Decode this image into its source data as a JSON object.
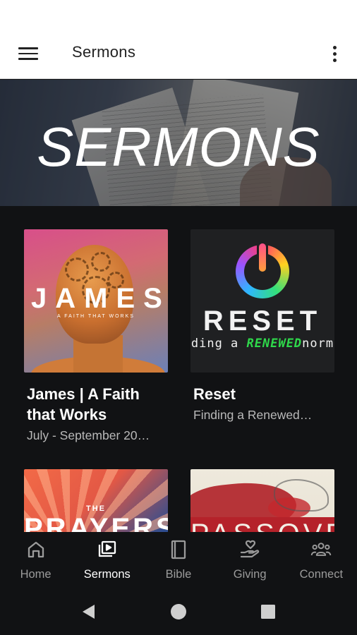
{
  "app_bar": {
    "title": "Sermons",
    "menu_icon": "hamburger-menu-icon",
    "overflow_icon": "more-vertical-icon"
  },
  "hero": {
    "title": "SERMONS"
  },
  "cards": [
    {
      "title": "James | A Faith that Works",
      "subtitle": "July - September 20…",
      "art": {
        "big": "JAMES",
        "small": "A FAITH THAT WORKS"
      }
    },
    {
      "title": "Reset",
      "subtitle": "Finding a Renewed…",
      "art": {
        "word": "RESET",
        "tag_start": "ding a ",
        "tag_mid": "RENEWED",
        "tag_end": "norm"
      }
    },
    {
      "title": "",
      "subtitle": "",
      "art": {
        "the": "THE",
        "word": "PRAYERS"
      }
    },
    {
      "title": "",
      "subtitle": "",
      "art": {
        "word": "PASSOVE"
      }
    }
  ],
  "bottom_nav": [
    {
      "label": "Home",
      "icon": "home-icon",
      "active": false
    },
    {
      "label": "Sermons",
      "icon": "video-library-icon",
      "active": true
    },
    {
      "label": "Bible",
      "icon": "book-icon",
      "active": false
    },
    {
      "label": "Giving",
      "icon": "giving-hand-icon",
      "active": false
    },
    {
      "label": "Connect",
      "icon": "group-icon",
      "active": false
    }
  ],
  "system_nav": {
    "back_icon": "back-triangle-icon",
    "home_icon": "home-circle-icon",
    "recents_icon": "recents-square-icon"
  },
  "colors": {
    "background": "#111214",
    "app_bar": "#ffffff",
    "nav_active": "#ffffff",
    "nav_inactive": "#9b9b9b",
    "card_subtitle": "#b9b9b9"
  }
}
